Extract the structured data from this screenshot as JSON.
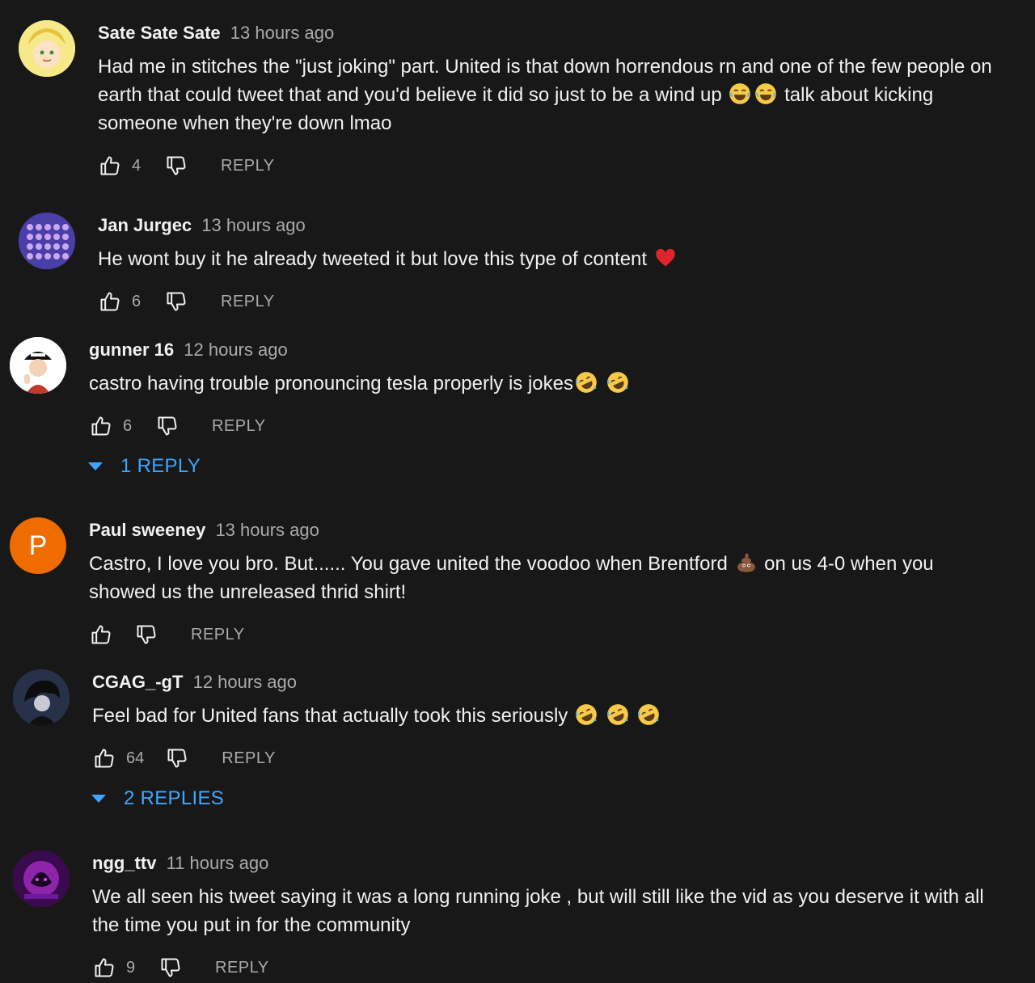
{
  "comments": [
    {
      "author": "Sate Sate Sate",
      "time": "13 hours ago",
      "text_parts": [
        "Had me in stitches the \"just joking\" part. United is that down horrendous rn and one of the few people on earth that could tweet that and you'd believe it did so just to be a wind up ",
        " talk about kicking someone when they're down lmao"
      ],
      "likes": "4",
      "reply_label": "REPLY",
      "avatar_color": "#f4e27a"
    },
    {
      "author": "Jan Jurgec",
      "time": "13 hours ago",
      "text_parts": [
        "He wont buy it he already tweeted it but love this type of content "
      ],
      "likes": "6",
      "reply_label": "REPLY",
      "avatar_color": "#5b4fb8"
    },
    {
      "author": "gunner 16",
      "time": "12 hours ago",
      "text_parts": [
        "castro having trouble pronouncing tesla properly is jokes"
      ],
      "likes": "6",
      "reply_label": "REPLY",
      "view_replies": "1 REPLY",
      "avatar_color": "#ffffff"
    },
    {
      "author": "Paul sweeney",
      "time": "13 hours ago",
      "avatar_letter": "P",
      "text_parts": [
        "Castro, I love you bro. But...... You gave united the voodoo when Brentford ",
        " on us 4-0 when you showed us the unreleased thrid shirt!"
      ],
      "likes": "",
      "reply_label": "REPLY",
      "avatar_color": "#ef6c00"
    },
    {
      "author": "CGAG_-gT",
      "time": "12 hours ago",
      "text_parts": [
        "Feel bad for United fans that actually took this seriously "
      ],
      "likes": "64",
      "reply_label": "REPLY",
      "view_replies": "2 REPLIES",
      "avatar_color": "#2b3a55"
    },
    {
      "author": "ngg_ttv",
      "time": "11 hours ago",
      "text_parts": [
        "We all seen his tweet saying it was a long running joke , but will still like the vid as you deserve it with all the time you put in for the community"
      ],
      "likes": "9",
      "reply_label": "REPLY",
      "avatar_color": "#7a1fa2"
    }
  ],
  "colors": {
    "background": "#181818",
    "text": "#f1f1f1",
    "secondary": "#aaaaaa",
    "link": "#3ea6ff"
  }
}
